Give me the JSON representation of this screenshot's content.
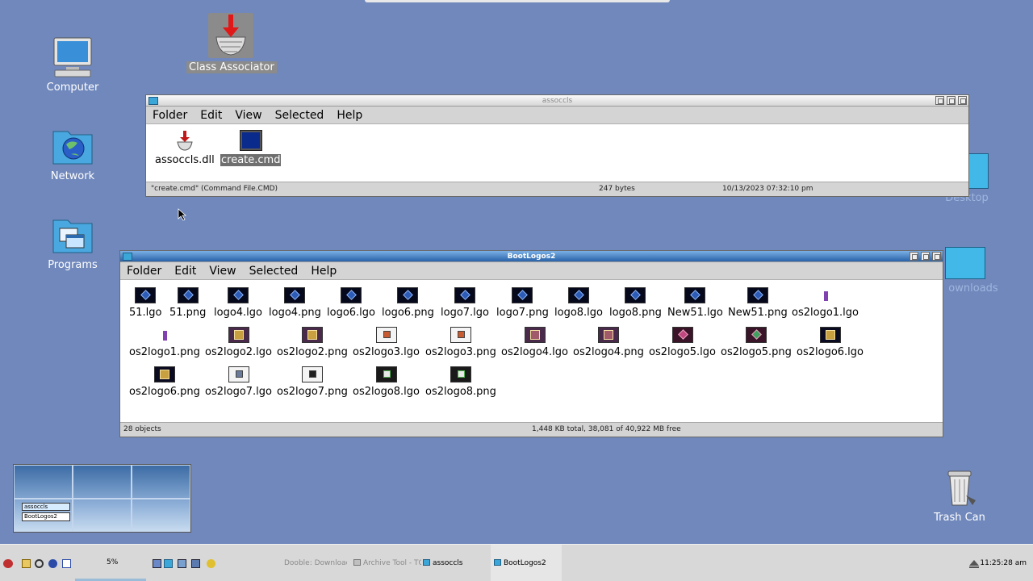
{
  "desktop": {
    "icons": [
      {
        "name": "computer",
        "label": "Computer"
      },
      {
        "name": "network",
        "label": "Network"
      },
      {
        "name": "programs",
        "label": "Programs"
      },
      {
        "name": "class-associator",
        "label": "Class Associator"
      },
      {
        "name": "desktop-folder",
        "label": "Desktop"
      },
      {
        "name": "downloads-folder",
        "label": "ownloads"
      },
      {
        "name": "trash-can",
        "label": "Trash Can"
      }
    ]
  },
  "windows": {
    "assoccls": {
      "title": "assoccls",
      "menu": [
        "Folder",
        "Edit",
        "View",
        "Selected",
        "Help"
      ],
      "files": [
        {
          "label": "assoccls.dll",
          "icon": "dll-icon",
          "selected": false
        },
        {
          "label": "create.cmd",
          "icon": "cmd-file-icon",
          "selected": true
        }
      ],
      "status": {
        "selection": "\"create.cmd\" (Command File.CMD)",
        "size": "247 bytes",
        "date": "10/13/2023 07:32:10 pm"
      }
    },
    "bootlogos": {
      "title": "BootLogos2",
      "menu": [
        "Folder",
        "Edit",
        "View",
        "Selected",
        "Help"
      ],
      "files": [
        "51.lgo",
        "51.png",
        "logo4.lgo",
        "logo4.png",
        "logo6.lgo",
        "logo6.png",
        "logo7.lgo",
        "logo7.png",
        "logo8.lgo",
        "logo8.png",
        "New51.lgo",
        "New51.png",
        "os2logo1.lgo",
        "os2logo1.png",
        "os2logo2.lgo",
        "os2logo2.png",
        "os2logo3.lgo",
        "os2logo3.png",
        "os2logo4.lgo",
        "os2logo4.png",
        "os2logo5.lgo",
        "os2logo5.png",
        "os2logo6.lgo",
        "os2logo6.png",
        "os2logo7.lgo",
        "os2logo7.png",
        "os2logo8.lgo",
        "os2logo8.png"
      ],
      "status": {
        "count": "28 objects",
        "space": "1,448 KB total, 38,081 of 40,922 MB free"
      }
    }
  },
  "switcher": {
    "windows": [
      "assoccls",
      "BootLogos2"
    ]
  },
  "taskbar": {
    "cpu": "5%",
    "tasks": [
      {
        "label": "Dooble: Downloads",
        "active": false
      },
      {
        "label": "Archive Tool - TOC",
        "active": false
      },
      {
        "label": "assoccls",
        "active": false
      },
      {
        "label": "BootLogos2",
        "active": true
      }
    ],
    "clock": "11:25:28 am"
  },
  "colors": {
    "desktop": "#7088bc",
    "active_title": "#2862a8",
    "selection": "#6f6f6f"
  }
}
